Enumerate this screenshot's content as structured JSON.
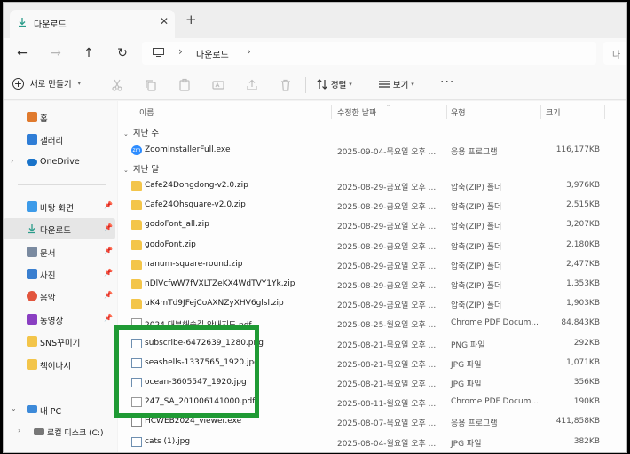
{
  "tab": {
    "title": "다운로드",
    "close": "✕",
    "new": "+"
  },
  "nav": {
    "back": "←",
    "forward": "→",
    "up": "↑",
    "refresh": "↻"
  },
  "address": {
    "location": "다운로드",
    "sep": "›"
  },
  "search": {
    "placeholder": "다"
  },
  "toolbar": {
    "new_label": "새로 만들기",
    "sort_label": "정렬",
    "view_label": "보기",
    "more": "···"
  },
  "sidebar": {
    "items": [
      {
        "label": "홈",
        "icon": "home-icon",
        "color": "#e07a2e"
      },
      {
        "label": "갤러리",
        "icon": "gallery-icon",
        "color": "#2f7dd6"
      },
      {
        "label": "OneDrive",
        "icon": "onedrive-icon",
        "color": "#1a73c9"
      },
      {
        "label": "바탕 화면",
        "icon": "desktop-icon",
        "color": "#3d9be9"
      },
      {
        "label": "다운로드",
        "icon": "download-icon",
        "color": "#2b9c8a"
      },
      {
        "label": "문서",
        "icon": "documents-icon",
        "color": "#7a8aa0"
      },
      {
        "label": "사진",
        "icon": "pictures-icon",
        "color": "#3a7fd0"
      },
      {
        "label": "음악",
        "icon": "music-icon",
        "color": "#e2553d"
      },
      {
        "label": "동영상",
        "icon": "videos-icon",
        "color": "#8a3fc2"
      },
      {
        "label": "SNS꾸미기",
        "icon": "folder-icon",
        "color": "#f3c54a"
      },
      {
        "label": "책이나시",
        "icon": "folder-icon",
        "color": "#f3c54a"
      },
      {
        "label": "내 PC",
        "icon": "pc-icon",
        "color": "#3d8ad9"
      },
      {
        "label": "로컬 디스크 (C:)",
        "icon": "drive-icon",
        "color": "#777777"
      }
    ]
  },
  "columns": {
    "name": "이름",
    "date": "수정한 날짜",
    "type": "유형",
    "size": "크기"
  },
  "groups": {
    "last_week": "지난 주",
    "last_month": "지난 달"
  },
  "files_last_week": [
    {
      "name": "ZoomInstallerFull.exe",
      "date": "2025-09-04-목요일 오후 ...",
      "type": "응용 프로그램",
      "size": "116,177KB",
      "icon": "zoom"
    }
  ],
  "files_last_month": [
    {
      "name": "Cafe24Dongdong-v2.0.zip",
      "date": "2025-08-29-금요일 오후 ...",
      "type": "압축(ZIP) 폴더",
      "size": "3,976KB",
      "icon": "folder"
    },
    {
      "name": "Cafe24Ohsquare-v2.0.zip",
      "date": "2025-08-29-금요일 오후 ...",
      "type": "압축(ZIP) 폴더",
      "size": "2,515KB",
      "icon": "folder"
    },
    {
      "name": "godoFont_all.zip",
      "date": "2025-08-29-금요일 오후 ...",
      "type": "압축(ZIP) 폴더",
      "size": "3,207KB",
      "icon": "folder"
    },
    {
      "name": "godoFont.zip",
      "date": "2025-08-29-금요일 오후 ...",
      "type": "압축(ZIP) 폴더",
      "size": "2,180KB",
      "icon": "folder"
    },
    {
      "name": "nanum-square-round.zip",
      "date": "2025-08-29-금요일 오후 ...",
      "type": "압축(ZIP) 폴더",
      "size": "2,477KB",
      "icon": "folder"
    },
    {
      "name": "nDlVcfwW7fVXLTZeKX4WdTVY1Yk.zip",
      "date": "2025-08-29-금요일 오후 ...",
      "type": "압축(ZIP) 폴더",
      "size": "1,353KB",
      "icon": "folder"
    },
    {
      "name": "uK4mTd9JFejCoAXNZyXHV6glsl.zip",
      "date": "2025-08-29-금요일 오후 ...",
      "type": "압축(ZIP) 폴더",
      "size": "1,903KB",
      "icon": "folder"
    },
    {
      "name": "2024 대부해솔길 안내지도.pdf",
      "date": "2025-08-25-월요일 오후 ...",
      "type": "Chrome PDF Docum...",
      "size": "84,843KB",
      "icon": "pdf"
    },
    {
      "name": "subscribe-6472639_1280.png",
      "date": "2025-08-21-목요일 오후 ...",
      "type": "PNG 파일",
      "size": "292KB",
      "icon": "img"
    },
    {
      "name": "seashells-1337565_1920.jpg",
      "date": "2025-08-21-목요일 오후 ...",
      "type": "JPG 파일",
      "size": "1,071KB",
      "icon": "img"
    },
    {
      "name": "ocean-3605547_1920.jpg",
      "date": "2025-08-21-목요일 오후 ...",
      "type": "JPG 파일",
      "size": "356KB",
      "icon": "img"
    },
    {
      "name": "247_SA_201006141000.pdf",
      "date": "2025-08-11-월요일 오후 ...",
      "type": "Chrome PDF Docum...",
      "size": "190KB",
      "icon": "pdf"
    },
    {
      "name": "HCWEB2024_viewer.exe",
      "date": "2025-08-07-목요일 오후 ...",
      "type": "응용 프로그램",
      "size": "411,858KB",
      "icon": "exe"
    },
    {
      "name": "cats (1).jpg",
      "date": "2025-08-04-월요일 오후 ...",
      "type": "JPG 파일",
      "size": "382KB",
      "icon": "img"
    }
  ],
  "colors": {
    "accent": "#0067c0",
    "highlight": "#1f9a34"
  }
}
